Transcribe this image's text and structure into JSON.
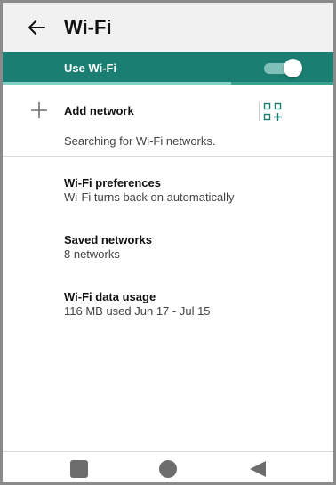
{
  "appbar": {
    "title": "Wi-Fi"
  },
  "use_wifi": {
    "label": "Use Wi-Fi",
    "enabled": true,
    "scan_progress": 0.69
  },
  "add_network": {
    "label": "Add network",
    "status": "Searching for Wi-Fi networks."
  },
  "items": [
    {
      "title": "Wi-Fi preferences",
      "subtitle": "Wi-Fi turns back on automatically"
    },
    {
      "title": "Saved networks",
      "subtitle": "8 networks"
    },
    {
      "title": "Wi-Fi data usage",
      "subtitle": "116 MB used Jun 17 - Jul 15"
    }
  ],
  "icons": {
    "back": "arrow-back-icon",
    "add": "plus-icon",
    "qr": "qr-code-scanner-icon",
    "nav_recent": "square-icon",
    "nav_home": "circle-icon",
    "nav_back": "triangle-back-icon"
  },
  "colors": {
    "accent": "#1a7f72",
    "appbar_bg": "#f1f1f1",
    "icon_gray": "#6d6d6d"
  }
}
